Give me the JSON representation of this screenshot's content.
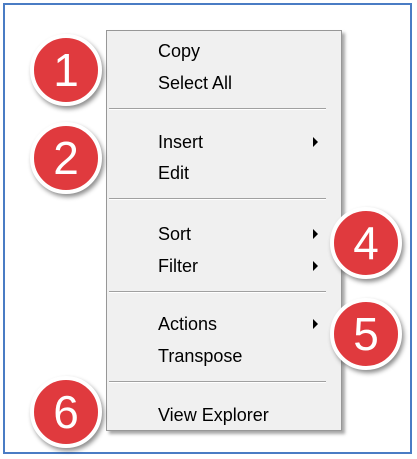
{
  "colors": {
    "window_border": "#4a7cc4",
    "menu_background": "#f0f0f0",
    "badge_fill": "#e03a3e"
  },
  "menu": {
    "items": [
      {
        "label": "Copy"
      },
      {
        "label": "Select All"
      },
      {
        "label": "Insert",
        "submenu_icon": "submenu-arrow-icon"
      },
      {
        "label": "Edit"
      },
      {
        "label": "Sort",
        "submenu_icon": "submenu-arrow-icon"
      },
      {
        "label": "Filter",
        "submenu_icon": "submenu-arrow-icon"
      },
      {
        "label": "Actions",
        "submenu_icon": "submenu-arrow-icon"
      },
      {
        "label": "Transpose"
      },
      {
        "label": "View Explorer"
      }
    ]
  },
  "callouts": [
    "1",
    "2",
    "4",
    "5",
    "6"
  ]
}
